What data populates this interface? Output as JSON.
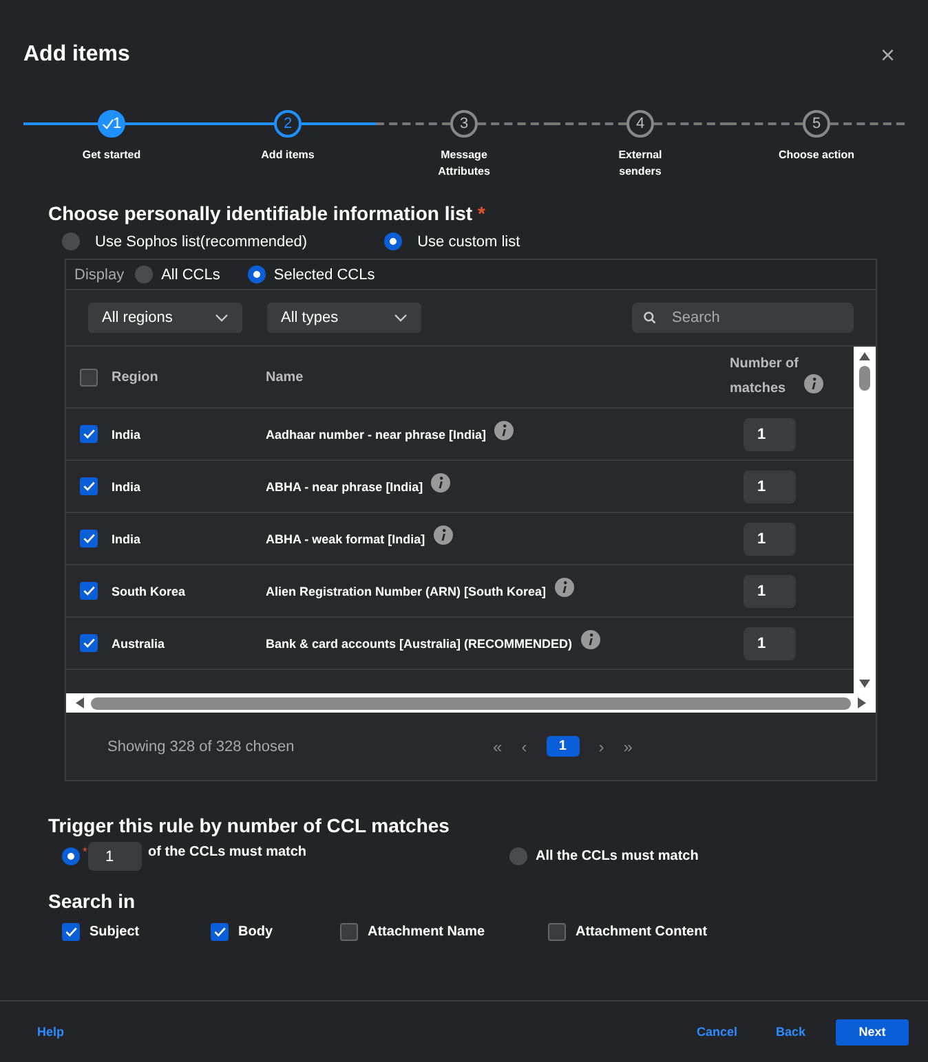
{
  "dialog": {
    "title": "Add items",
    "close": "×"
  },
  "steps": [
    {
      "number": "1",
      "label": "Get started",
      "completed": true,
      "selected": false
    },
    {
      "number": "2",
      "label": "Add items",
      "completed": false,
      "selected": true
    },
    {
      "number": "3",
      "label": "Message\nAttributes",
      "completed": false,
      "selected": false
    },
    {
      "number": "4",
      "label": "External\nsenders",
      "completed": false,
      "selected": false
    },
    {
      "number": "5",
      "label": "Choose action",
      "completed": false,
      "selected": false
    }
  ],
  "list_section": {
    "title": "Choose personally identifiable information list",
    "required_mark": "*",
    "options": [
      {
        "label": "Use Sophos list(recommended)",
        "selected": false
      },
      {
        "label": "Use custom list",
        "selected": true
      }
    ]
  },
  "panel": {
    "display_label": "Display",
    "display_options": [
      {
        "label": "All CCLs",
        "selected": false
      },
      {
        "label": "Selected CCLs",
        "selected": true
      }
    ],
    "filters": [
      {
        "label": "All regions"
      },
      {
        "label": "All types"
      }
    ],
    "search": {
      "placeholder": "Search"
    },
    "table": {
      "select_all_checked": false,
      "columns": [
        "Region",
        "Name",
        "Number of matches"
      ],
      "rows": [
        {
          "checked": true,
          "region": "India",
          "name": "Aadhaar number - near phrase [India]",
          "matches": "1"
        },
        {
          "checked": true,
          "region": "India",
          "name": "ABHA - near phrase [India]",
          "matches": "1"
        },
        {
          "checked": true,
          "region": "India",
          "name": "ABHA - weak format [India]",
          "matches": "1"
        },
        {
          "checked": true,
          "region": "South Korea",
          "name": "Alien Registration Number (ARN) [South Korea]",
          "matches": "1"
        },
        {
          "checked": true,
          "region": "Australia",
          "name": "Bank & card accounts [Australia] (RECOMMENDED)",
          "matches": "1"
        }
      ]
    },
    "summary": "Showing 328 of 328 chosen",
    "pagination": {
      "first": "«",
      "prev": "‹",
      "pages": [
        {
          "label": "1",
          "selected": true
        }
      ],
      "next": "›",
      "last": "»"
    }
  },
  "trigger": {
    "title": "Trigger this rule by number of CCL matches",
    "options": [
      {
        "kind": "count",
        "selected": true,
        "required_mark": "*",
        "value": "1",
        "label": "of the CCLs must match"
      },
      {
        "kind": "all",
        "selected": false,
        "label": "All the CCLs must match"
      }
    ]
  },
  "search_in": {
    "title": "Search in",
    "options": [
      {
        "label": "Subject",
        "checked": true
      },
      {
        "label": "Body",
        "checked": true
      },
      {
        "label": "Attachment Name",
        "checked": false
      },
      {
        "label": "Attachment Content",
        "checked": false
      }
    ]
  },
  "footer": {
    "help": "Help",
    "cancel": "Cancel",
    "back": "Back",
    "next": "Next"
  }
}
